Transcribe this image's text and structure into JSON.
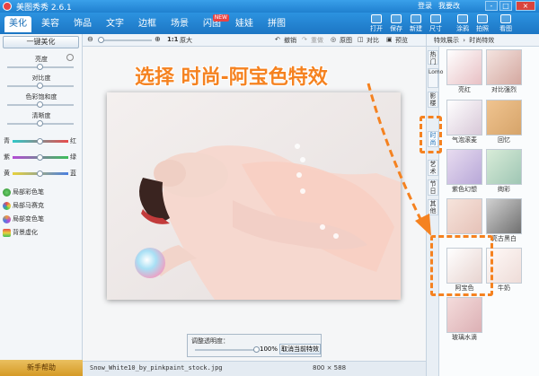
{
  "app": {
    "title": "美图秀秀 2.6.1",
    "login": "登录",
    "modify": "我要改"
  },
  "window_buttons": {
    "minimize": "-",
    "maximize": "□",
    "close": "×"
  },
  "tabs": [
    {
      "label": "美化",
      "active": true
    },
    {
      "label": "美容"
    },
    {
      "label": "饰品"
    },
    {
      "label": "文字"
    },
    {
      "label": "边框"
    },
    {
      "label": "场景"
    },
    {
      "label": "闪图",
      "badge": "NEW"
    },
    {
      "label": "娃娃"
    },
    {
      "label": "拼图"
    }
  ],
  "toolbar": [
    {
      "label": "打开",
      "icon": "folder-icon"
    },
    {
      "label": "保存",
      "icon": "save-icon"
    },
    {
      "label": "新建",
      "icon": "new-icon"
    },
    {
      "label": "尺寸",
      "icon": "resize-icon"
    },
    {
      "label": "涂鸦",
      "icon": "brush-icon"
    },
    {
      "label": "拍照",
      "icon": "camera-icon"
    },
    {
      "label": "看图",
      "icon": "view-icon"
    }
  ],
  "left_panel": {
    "one_key_label": "一键美化",
    "sliders": [
      {
        "label": "亮度",
        "value": 0.5
      },
      {
        "label": "对比度",
        "value": 0.5
      },
      {
        "label": "色彩饱和度",
        "value": 0.5
      },
      {
        "label": "清晰度",
        "value": 0.5
      }
    ],
    "color_sliders": [
      {
        "left": "青",
        "right": "红",
        "value": 0.5,
        "color": "#e84c4c"
      },
      {
        "left": "紫",
        "right": "绿",
        "value": 0.5,
        "color": "#3cbf5a"
      },
      {
        "left": "黄",
        "right": "蓝",
        "value": 0.5,
        "color": "#4a7fe0"
      }
    ],
    "brushes": [
      {
        "label": "局部彩色笔",
        "icon": "color-brush-icon"
      },
      {
        "label": "局部马赛克",
        "icon": "mosaic-icon"
      },
      {
        "label": "局部变色笔",
        "icon": "recolor-icon"
      },
      {
        "label": "背景虚化",
        "icon": "blur-icon"
      }
    ],
    "help_label": "新手帮助"
  },
  "edit_toolbar": {
    "zoom_ratio": "1:1",
    "original_size": "原大",
    "undo": "撤销",
    "redo": "重做",
    "original": "原图",
    "compare": "对比",
    "preview": "预览"
  },
  "opacity": {
    "label": "调整透明度：",
    "value": "100%",
    "cancel": "取消当前特效"
  },
  "status": {
    "filename": "Snow_White10_by_pinkpaint_stock.jpg",
    "dimensions": "800 × 588"
  },
  "right_panel": {
    "header_left": "特效展示",
    "header_sep": "›",
    "header_right": "时尚特效",
    "vtabs": [
      "热门",
      "Lomo",
      "影楼",
      "时尚",
      "艺术",
      "节日",
      "其他"
    ],
    "effects": [
      {
        "label": "亮红",
        "color": "#e8c0c4"
      },
      {
        "label": "对比强烈",
        "color": "#d4a8a0"
      },
      {
        "label": "气泡滚麦",
        "color": "#d8c8d8"
      },
      {
        "label": "回忆",
        "color": "#d6a46a"
      },
      {
        "label": "紫色幻想",
        "color": "#b8a8d8"
      },
      {
        "label": "绚彩",
        "color": "#9fc6b4"
      },
      {
        "label": "",
        "color": "#e6c2b8"
      },
      {
        "label": "亮古黑白",
        "color": "#9a9a9a"
      },
      {
        "label": "阿宝色",
        "color": "#e8d4d0"
      },
      {
        "label": "牛奶",
        "color": "#eedcd8"
      },
      {
        "label": "玻璃水滴",
        "color": "#dcb0b4"
      }
    ]
  },
  "annotation": {
    "text": "选择 时尚-阿宝色特效"
  }
}
